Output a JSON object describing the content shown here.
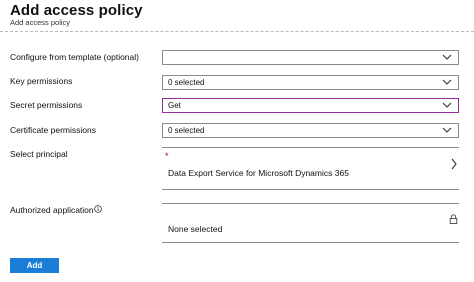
{
  "header": {
    "title": "Add access policy",
    "subtitle": "Add access policy"
  },
  "form": {
    "template": {
      "label": "Configure from template (optional)",
      "value": ""
    },
    "key_permissions": {
      "label": "Key permissions",
      "value": "0 selected"
    },
    "secret_permissions": {
      "label": "Secret permissions",
      "value": "Get"
    },
    "certificate_permissions": {
      "label": "Certificate permissions",
      "value": "0 selected"
    },
    "principal": {
      "label": "Select principal",
      "required_marker": "*",
      "value": "Data Export Service for Microsoft Dynamics 365"
    },
    "authorized_application": {
      "label": "Authorized application",
      "value": "None selected"
    }
  },
  "actions": {
    "add_label": "Add"
  },
  "colors": {
    "accent_button": "#1a7dd7",
    "active_border": "#9b2a9b",
    "required_marker": "#c00000"
  },
  "icons": [
    "chevron-down-icon",
    "chevron-right-icon",
    "info-icon",
    "lock-icon"
  ]
}
